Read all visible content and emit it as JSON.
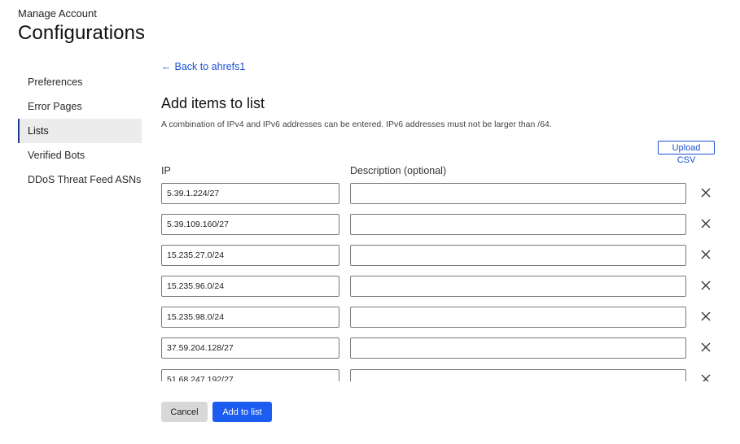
{
  "header": {
    "eyebrow": "Manage Account",
    "title": "Configurations"
  },
  "sidebar": {
    "items": [
      {
        "label": "Preferences",
        "active": false
      },
      {
        "label": "Error Pages",
        "active": false
      },
      {
        "label": "Lists",
        "active": true
      },
      {
        "label": "Verified Bots",
        "active": false
      },
      {
        "label": "DDoS Threat Feed ASNs",
        "active": false
      }
    ]
  },
  "main": {
    "back_link": "Back to ahrefs1",
    "back_arrow": "←",
    "section_title": "Add items to list",
    "help_text": "A combination of IPv4 and IPv6 addresses can be entered. IPv6 addresses must not be larger than /64.",
    "upload_label": "Upload CSV",
    "columns": {
      "ip": "IP",
      "description": "Description (optional)"
    },
    "rows": [
      {
        "ip": "5.39.1.224/27",
        "description": ""
      },
      {
        "ip": "5.39.109.160/27",
        "description": ""
      },
      {
        "ip": "15.235.27.0/24",
        "description": ""
      },
      {
        "ip": "15.235.96.0/24",
        "description": ""
      },
      {
        "ip": "15.235.98.0/24",
        "description": ""
      },
      {
        "ip": "37.59.204.128/27",
        "description": ""
      },
      {
        "ip": "51.68.247.192/27",
        "description": ""
      }
    ]
  },
  "footer": {
    "cancel_label": "Cancel",
    "add_label": "Add to list"
  },
  "colors": {
    "accent": "#1d5cf0",
    "link": "#1d4fd6",
    "active_border": "#1f3b8f"
  },
  "icons": {
    "remove": "close-icon",
    "back": "arrow-left-icon"
  }
}
